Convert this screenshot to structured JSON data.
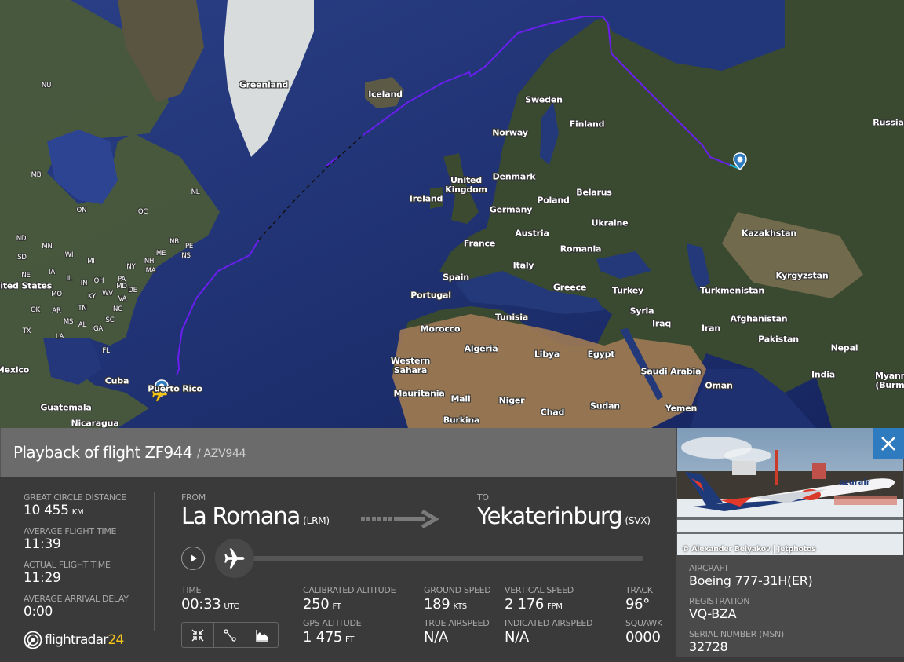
{
  "map": {
    "labels": {
      "greenland": "Greenland",
      "iceland": "Iceland",
      "sweden": "Sweden",
      "norway": "Norway",
      "finland": "Finland",
      "russia": "Russia",
      "uk": "United Kingdom",
      "ireland": "Ireland",
      "denmark": "Denmark",
      "belarus": "Belarus",
      "poland": "Poland",
      "germany": "Germany",
      "ukraine": "Ukraine",
      "austria": "Austria",
      "france": "France",
      "romania": "Romania",
      "kazakhstan": "Kazakhstan",
      "italy": "Italy",
      "spain": "Spain",
      "portugal": "Portugal",
      "greece": "Greece",
      "turkey": "Turkey",
      "kyrgyzstan": "Kyrgyzstan",
      "turkmenistan": "Turkmenistan",
      "syria": "Syria",
      "iraq": "Iraq",
      "iran": "Iran",
      "afghanistan": "Afghanistan",
      "tunisia": "Tunisia",
      "morocco": "Morocco",
      "pakistan": "Pakistan",
      "algeria": "Algeria",
      "libya": "Libya",
      "egypt": "Egypt",
      "nepal": "Nepal",
      "western_sahara": "Western Sahara",
      "saudi_arabia": "Saudi Arabia",
      "india": "India",
      "oman": "Oman",
      "myanmar": "Myanmar (Burma)",
      "mauritania": "Mauritania",
      "mali": "Mali",
      "niger": "Niger",
      "sudan": "Sudan",
      "yemen": "Yemen",
      "chad": "Chad",
      "burkina": "Burkina",
      "united_states": "United States",
      "mexico": "Mexico",
      "cuba": "Cuba",
      "puerto_rico": "Puerto Rico",
      "guatemala": "Guatemala",
      "nicaragua": "Nicaragua"
    },
    "states": [
      "NU",
      "MB",
      "ON",
      "QC",
      "NL",
      "ND",
      "MN",
      "SD",
      "WI",
      "MI",
      "NE",
      "IA",
      "IL",
      "IN",
      "OH",
      "NY",
      "PA",
      "MD",
      "DE",
      "MO",
      "KY",
      "WV",
      "VA",
      "OK",
      "AR",
      "TN",
      "NC",
      "MS",
      "AL",
      "GA",
      "SC",
      "TX",
      "LA",
      "FL",
      "NB",
      "PE",
      "NS",
      "ME",
      "NH",
      "MA"
    ],
    "route_color": "#6a1ff0"
  },
  "panel": {
    "title": "Playback of flight ZF944",
    "callsign": "/ AZV944",
    "stats": [
      {
        "label": "GREAT CIRCLE DISTANCE",
        "value": "10 455",
        "unit": "KM"
      },
      {
        "label": "AVERAGE FLIGHT TIME",
        "value": "11:39",
        "unit": ""
      },
      {
        "label": "ACTUAL FLIGHT TIME",
        "value": "11:29",
        "unit": ""
      },
      {
        "label": "AVERAGE ARRIVAL DELAY",
        "value": "0:00",
        "unit": ""
      }
    ],
    "logo": {
      "name": "flightradar",
      "num": "24"
    },
    "from": {
      "label": "FROM",
      "city": "La Romana",
      "code": "(LRM)"
    },
    "to": {
      "label": "TO",
      "city": "Yekaterinburg",
      "code": "(SVX)"
    },
    "playback_progress": 0.0,
    "time": {
      "label": "TIME",
      "value": "00:33",
      "unit": "UTC"
    },
    "calibrated_altitude": {
      "label": "CALIBRATED ALTITUDE",
      "value": "250",
      "unit": "FT"
    },
    "gps_altitude": {
      "label": "GPS ALTITUDE",
      "value": "1 475",
      "unit": "FT"
    },
    "ground_speed": {
      "label": "GROUND SPEED",
      "value": "189",
      "unit": "KTS"
    },
    "true_airspeed": {
      "label": "TRUE AIRSPEED",
      "value": "N/A",
      "unit": ""
    },
    "vertical_speed": {
      "label": "VERTICAL SPEED",
      "value": "2 176",
      "unit": "FPM"
    },
    "indicated_airspeed": {
      "label": "INDICATED AIRSPEED",
      "value": "N/A",
      "unit": ""
    },
    "track": {
      "label": "TRACK",
      "value": "96°",
      "unit": ""
    },
    "squawk": {
      "label": "SQUAWK",
      "value": "0000",
      "unit": ""
    }
  },
  "aircraft": {
    "photo_credit": "© Alexander Belyakov | Jetphotos",
    "livery_text": "azurair",
    "aircraft": {
      "label": "AIRCRAFT",
      "value": "Boeing 777-31H(ER)"
    },
    "registration": {
      "label": "REGISTRATION",
      "value": "VQ-BZA"
    },
    "serial": {
      "label": "SERIAL NUMBER (MSN)",
      "value": "32728"
    }
  }
}
